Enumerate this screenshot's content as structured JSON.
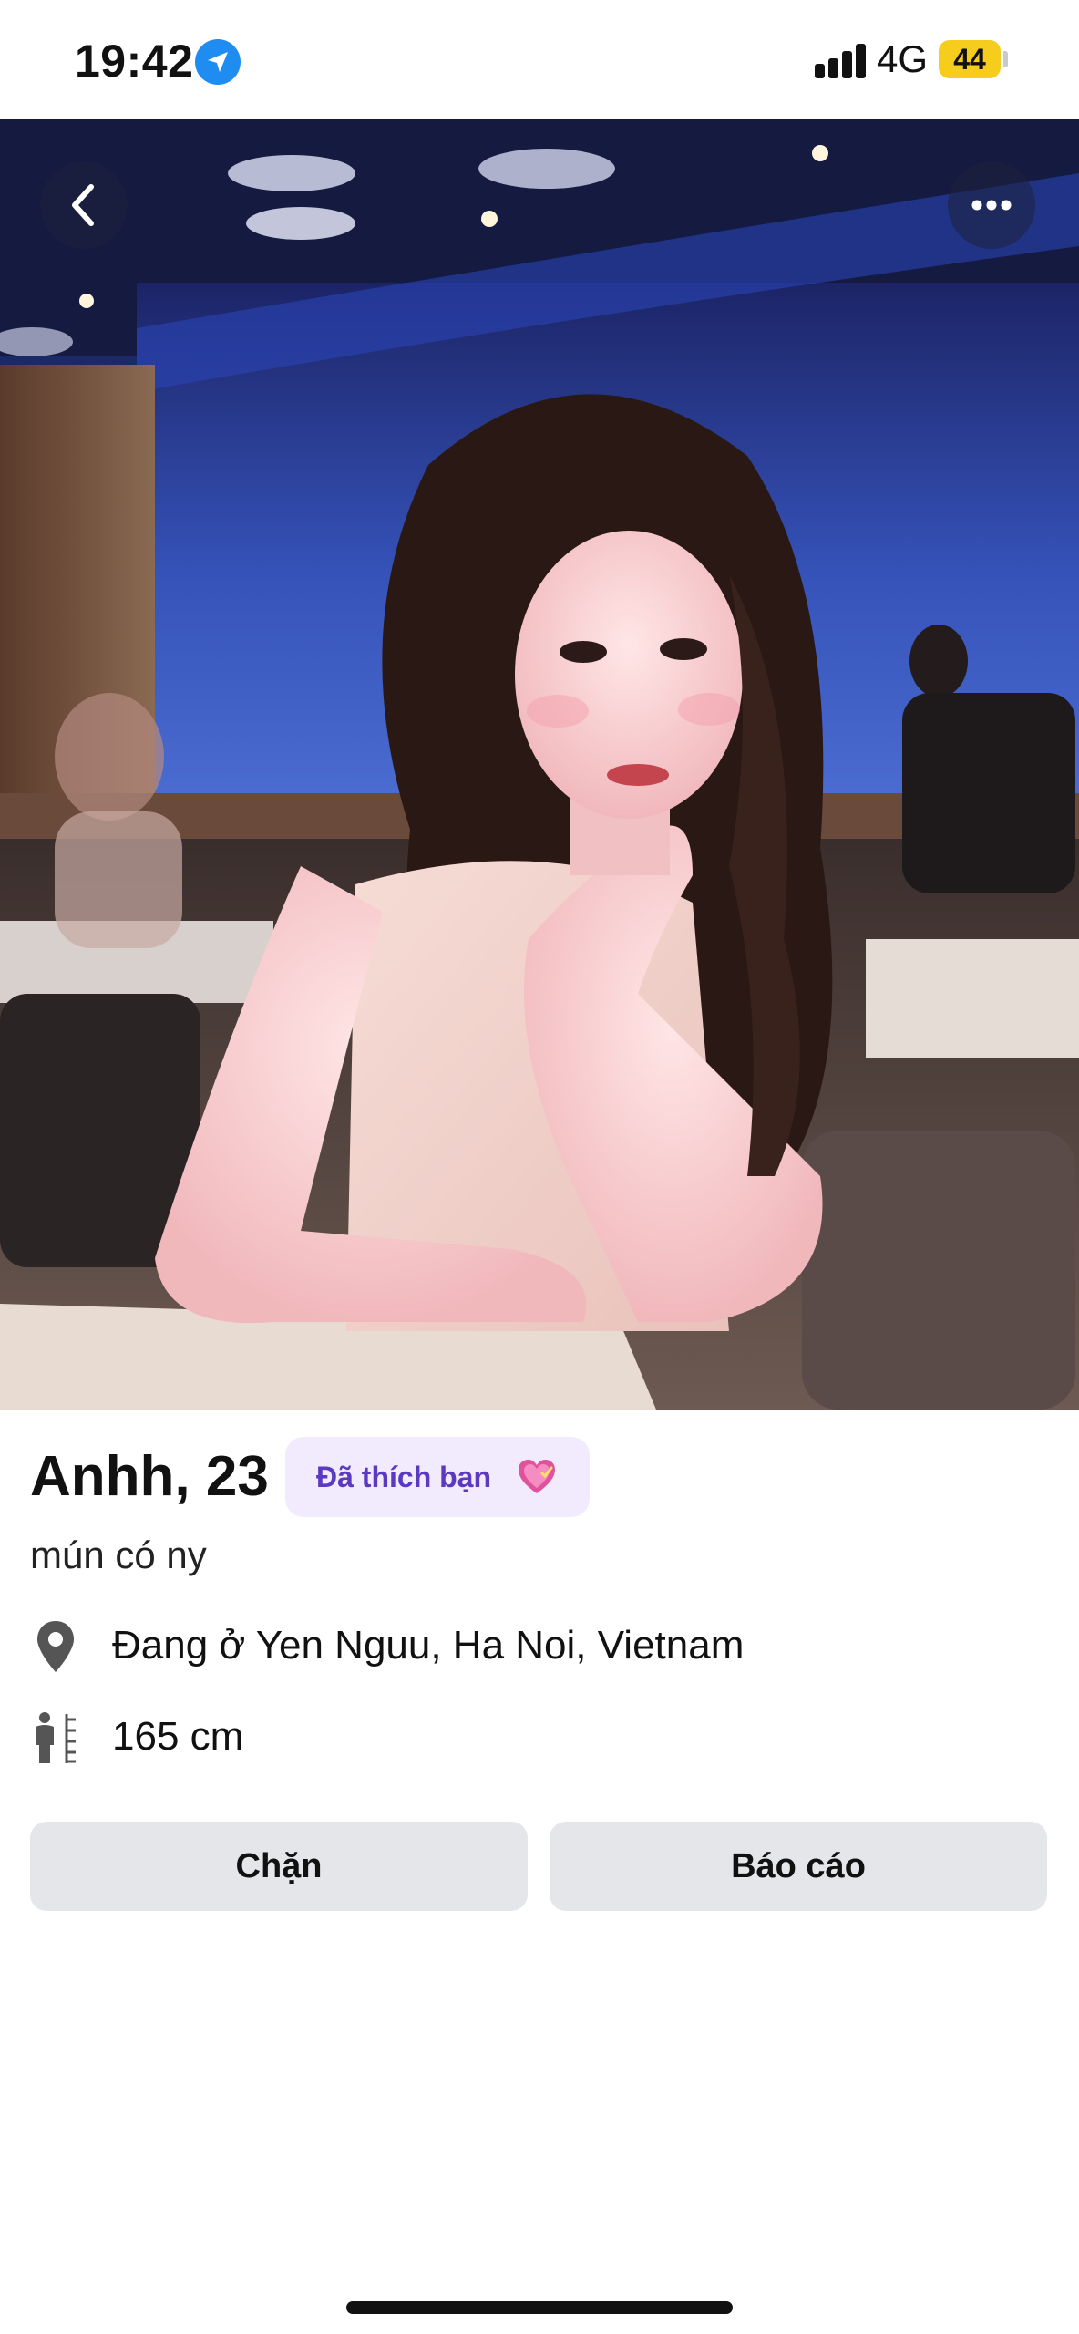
{
  "status_bar": {
    "time": "19:42",
    "network": "4G",
    "battery": "44"
  },
  "profile": {
    "name_age": "Anhh, 23",
    "liked_badge": "Đã thích bạn",
    "bio": "mún có ny",
    "location": "Đang ở Yen Nguu, Ha Noi, Vietnam",
    "height": "165 cm"
  },
  "actions": {
    "block_label": "Chặn",
    "report_label": "Báo cáo"
  },
  "icons": {
    "status": [
      "location-arrow-icon",
      "signal-icon",
      "battery-icon"
    ],
    "photo_overlay": [
      "back-icon",
      "more-icon"
    ],
    "info": [
      "location-pin-icon",
      "height-icon",
      "heart-icon"
    ]
  },
  "colors": {
    "badge_background": "#f1ebfd",
    "badge_text": "#5b39c0",
    "button_background": "#e4e6ea",
    "location_arrow": "#1f8cf2",
    "battery": "#f6cd1d"
  }
}
